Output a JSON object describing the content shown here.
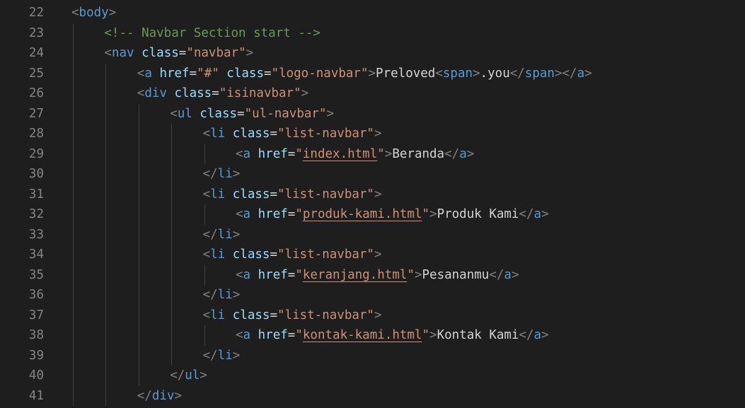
{
  "editor": {
    "lines": [
      {
        "num": "22",
        "indent": 0,
        "tokens": [
          {
            "t": "<",
            "c": "pu"
          },
          {
            "t": "body",
            "c": "tg"
          },
          {
            "t": ">",
            "c": "pu"
          }
        ]
      },
      {
        "num": "23",
        "indent": 1,
        "tokens": [
          {
            "t": "<!-- Navbar Section start -->",
            "c": "cm"
          }
        ]
      },
      {
        "num": "24",
        "indent": 1,
        "tokens": [
          {
            "t": "<",
            "c": "pu"
          },
          {
            "t": "nav",
            "c": "tg"
          },
          {
            "t": " ",
            "c": "tx"
          },
          {
            "t": "class",
            "c": "at"
          },
          {
            "t": "=",
            "c": "tx"
          },
          {
            "t": "\"navbar\"",
            "c": "st"
          },
          {
            "t": ">",
            "c": "pu"
          }
        ]
      },
      {
        "num": "25",
        "indent": 2,
        "tokens": [
          {
            "t": "<",
            "c": "pu"
          },
          {
            "t": "a",
            "c": "tg"
          },
          {
            "t": " ",
            "c": "tx"
          },
          {
            "t": "href",
            "c": "at"
          },
          {
            "t": "=",
            "c": "tx"
          },
          {
            "t": "\"#\"",
            "c": "st"
          },
          {
            "t": " ",
            "c": "tx"
          },
          {
            "t": "class",
            "c": "at"
          },
          {
            "t": "=",
            "c": "tx"
          },
          {
            "t": "\"logo-navbar\"",
            "c": "st"
          },
          {
            "t": ">",
            "c": "pu"
          },
          {
            "t": "Preloved",
            "c": "tx"
          },
          {
            "t": "<",
            "c": "pu"
          },
          {
            "t": "span",
            "c": "tg"
          },
          {
            "t": ">",
            "c": "pu"
          },
          {
            "t": ".you",
            "c": "tx"
          },
          {
            "t": "</",
            "c": "pu"
          },
          {
            "t": "span",
            "c": "tg"
          },
          {
            "t": "></",
            "c": "pu"
          },
          {
            "t": "a",
            "c": "tg"
          },
          {
            "t": ">",
            "c": "pu"
          }
        ]
      },
      {
        "num": "26",
        "indent": 2,
        "tokens": [
          {
            "t": "<",
            "c": "pu"
          },
          {
            "t": "div",
            "c": "tg"
          },
          {
            "t": " ",
            "c": "tx"
          },
          {
            "t": "class",
            "c": "at"
          },
          {
            "t": "=",
            "c": "tx"
          },
          {
            "t": "\"isinavbar\"",
            "c": "st"
          },
          {
            "t": ">",
            "c": "pu"
          }
        ]
      },
      {
        "num": "27",
        "indent": 3,
        "tokens": [
          {
            "t": "<",
            "c": "pu"
          },
          {
            "t": "ul",
            "c": "tg"
          },
          {
            "t": " ",
            "c": "tx"
          },
          {
            "t": "class",
            "c": "at"
          },
          {
            "t": "=",
            "c": "tx"
          },
          {
            "t": "\"ul-navbar\"",
            "c": "st"
          },
          {
            "t": ">",
            "c": "pu"
          }
        ]
      },
      {
        "num": "28",
        "indent": 4,
        "tokens": [
          {
            "t": "<",
            "c": "pu"
          },
          {
            "t": "li",
            "c": "tg"
          },
          {
            "t": " ",
            "c": "tx"
          },
          {
            "t": "class",
            "c": "at"
          },
          {
            "t": "=",
            "c": "tx"
          },
          {
            "t": "\"list-navbar\"",
            "c": "st"
          },
          {
            "t": ">",
            "c": "pu"
          }
        ]
      },
      {
        "num": "29",
        "indent": 5,
        "tokens": [
          {
            "t": "<",
            "c": "pu"
          },
          {
            "t": "a",
            "c": "tg"
          },
          {
            "t": " ",
            "c": "tx"
          },
          {
            "t": "href",
            "c": "at"
          },
          {
            "t": "=",
            "c": "tx"
          },
          {
            "t": "\"",
            "c": "st"
          },
          {
            "t": "index.html",
            "c": "st lk"
          },
          {
            "t": "\"",
            "c": "st"
          },
          {
            "t": ">",
            "c": "pu"
          },
          {
            "t": "Beranda",
            "c": "tx"
          },
          {
            "t": "</",
            "c": "pu"
          },
          {
            "t": "a",
            "c": "tg"
          },
          {
            "t": ">",
            "c": "pu"
          }
        ]
      },
      {
        "num": "30",
        "indent": 4,
        "tokens": [
          {
            "t": "</",
            "c": "pu"
          },
          {
            "t": "li",
            "c": "tg"
          },
          {
            "t": ">",
            "c": "pu"
          }
        ]
      },
      {
        "num": "31",
        "indent": 4,
        "tokens": [
          {
            "t": "<",
            "c": "pu"
          },
          {
            "t": "li",
            "c": "tg"
          },
          {
            "t": " ",
            "c": "tx"
          },
          {
            "t": "class",
            "c": "at"
          },
          {
            "t": "=",
            "c": "tx"
          },
          {
            "t": "\"list-navbar\"",
            "c": "st"
          },
          {
            "t": ">",
            "c": "pu"
          }
        ]
      },
      {
        "num": "32",
        "indent": 5,
        "tokens": [
          {
            "t": "<",
            "c": "pu"
          },
          {
            "t": "a",
            "c": "tg"
          },
          {
            "t": " ",
            "c": "tx"
          },
          {
            "t": "href",
            "c": "at"
          },
          {
            "t": "=",
            "c": "tx"
          },
          {
            "t": "\"",
            "c": "st"
          },
          {
            "t": "produk-kami.html",
            "c": "st lk"
          },
          {
            "t": "\"",
            "c": "st"
          },
          {
            "t": ">",
            "c": "pu"
          },
          {
            "t": "Produk Kami",
            "c": "tx"
          },
          {
            "t": "</",
            "c": "pu"
          },
          {
            "t": "a",
            "c": "tg"
          },
          {
            "t": ">",
            "c": "pu"
          }
        ]
      },
      {
        "num": "33",
        "indent": 4,
        "tokens": [
          {
            "t": "</",
            "c": "pu"
          },
          {
            "t": "li",
            "c": "tg"
          },
          {
            "t": ">",
            "c": "pu"
          }
        ]
      },
      {
        "num": "34",
        "indent": 4,
        "tokens": [
          {
            "t": "<",
            "c": "pu"
          },
          {
            "t": "li",
            "c": "tg"
          },
          {
            "t": " ",
            "c": "tx"
          },
          {
            "t": "class",
            "c": "at"
          },
          {
            "t": "=",
            "c": "tx"
          },
          {
            "t": "\"list-navbar\"",
            "c": "st"
          },
          {
            "t": ">",
            "c": "pu"
          }
        ]
      },
      {
        "num": "35",
        "indent": 5,
        "tokens": [
          {
            "t": "<",
            "c": "pu"
          },
          {
            "t": "a",
            "c": "tg"
          },
          {
            "t": " ",
            "c": "tx"
          },
          {
            "t": "href",
            "c": "at"
          },
          {
            "t": "=",
            "c": "tx"
          },
          {
            "t": "\"",
            "c": "st"
          },
          {
            "t": "keranjang.html",
            "c": "st lk"
          },
          {
            "t": "\"",
            "c": "st"
          },
          {
            "t": ">",
            "c": "pu"
          },
          {
            "t": "Pesananmu",
            "c": "tx"
          },
          {
            "t": "</",
            "c": "pu"
          },
          {
            "t": "a",
            "c": "tg"
          },
          {
            "t": ">",
            "c": "pu"
          }
        ]
      },
      {
        "num": "36",
        "indent": 4,
        "tokens": [
          {
            "t": "</",
            "c": "pu"
          },
          {
            "t": "li",
            "c": "tg"
          },
          {
            "t": ">",
            "c": "pu"
          }
        ]
      },
      {
        "num": "37",
        "indent": 4,
        "tokens": [
          {
            "t": "<",
            "c": "pu"
          },
          {
            "t": "li",
            "c": "tg"
          },
          {
            "t": " ",
            "c": "tx"
          },
          {
            "t": "class",
            "c": "at"
          },
          {
            "t": "=",
            "c": "tx"
          },
          {
            "t": "\"list-navbar\"",
            "c": "st"
          },
          {
            "t": ">",
            "c": "pu"
          }
        ]
      },
      {
        "num": "38",
        "indent": 5,
        "tokens": [
          {
            "t": "<",
            "c": "pu"
          },
          {
            "t": "a",
            "c": "tg"
          },
          {
            "t": " ",
            "c": "tx"
          },
          {
            "t": "href",
            "c": "at"
          },
          {
            "t": "=",
            "c": "tx"
          },
          {
            "t": "\"",
            "c": "st"
          },
          {
            "t": "kontak-kami.html",
            "c": "st lk"
          },
          {
            "t": "\"",
            "c": "st"
          },
          {
            "t": ">",
            "c": "pu"
          },
          {
            "t": "Kontak Kami",
            "c": "tx"
          },
          {
            "t": "</",
            "c": "pu"
          },
          {
            "t": "a",
            "c": "tg"
          },
          {
            "t": ">",
            "c": "pu"
          }
        ]
      },
      {
        "num": "39",
        "indent": 4,
        "tokens": [
          {
            "t": "</",
            "c": "pu"
          },
          {
            "t": "li",
            "c": "tg"
          },
          {
            "t": ">",
            "c": "pu"
          }
        ]
      },
      {
        "num": "40",
        "indent": 3,
        "tokens": [
          {
            "t": "</",
            "c": "pu"
          },
          {
            "t": "ul",
            "c": "tg"
          },
          {
            "t": ">",
            "c": "pu"
          }
        ]
      },
      {
        "num": "41",
        "indent": 2,
        "tokens": [
          {
            "t": "</",
            "c": "pu"
          },
          {
            "t": "div",
            "c": "tg"
          },
          {
            "t": ">",
            "c": "pu"
          }
        ]
      }
    ]
  },
  "theme": {
    "background": "#1e1e1e",
    "line_number": "#858585",
    "tag": "#569cd6",
    "attribute": "#9cdcfe",
    "string": "#ce9178",
    "comment": "#6a9955",
    "text": "#d4d4d4",
    "punctuation": "#808080"
  }
}
